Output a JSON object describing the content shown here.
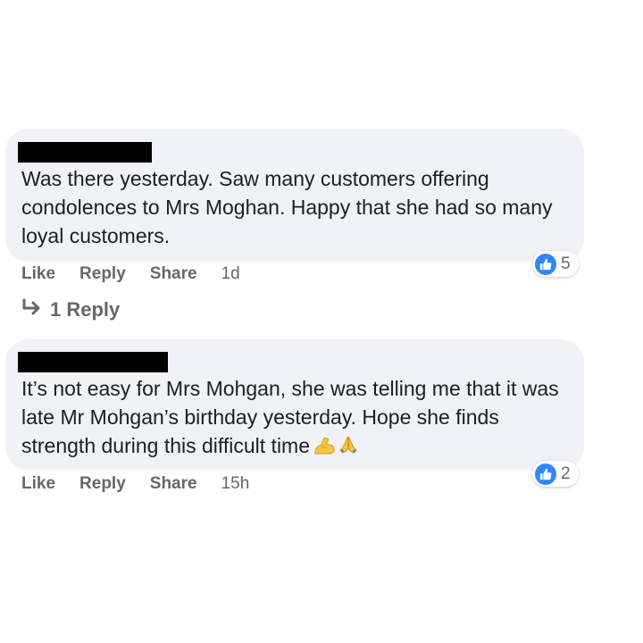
{
  "comments": [
    {
      "text": "Was there yesterday. Saw many customers offering condolences to Mrs Moghan. Happy that she had so many loyal customers.",
      "reaction_count": "5",
      "reaction_icon": "like-icon",
      "actions": {
        "like": "Like",
        "reply": "Reply",
        "share": "Share"
      },
      "timestamp": "1d",
      "replies_link": "1 Reply"
    },
    {
      "text": "It’s not easy for Mrs Mohgan, she was telling me that it was late Mr Mohgan’s birthday yesterday. Hope she finds strength during this difficult time",
      "emojis": [
        "flexed-biceps-emoji",
        "folded-hands-emoji"
      ],
      "reaction_count": "2",
      "reaction_icon": "like-icon",
      "actions": {
        "like": "Like",
        "reply": "Reply",
        "share": "Share"
      },
      "timestamp": "15h"
    }
  ],
  "colors": {
    "bubble_bg": "#f0f2f5",
    "meta_text": "#65676b",
    "like_blue": "#2d88ff",
    "redaction": "#000000"
  }
}
